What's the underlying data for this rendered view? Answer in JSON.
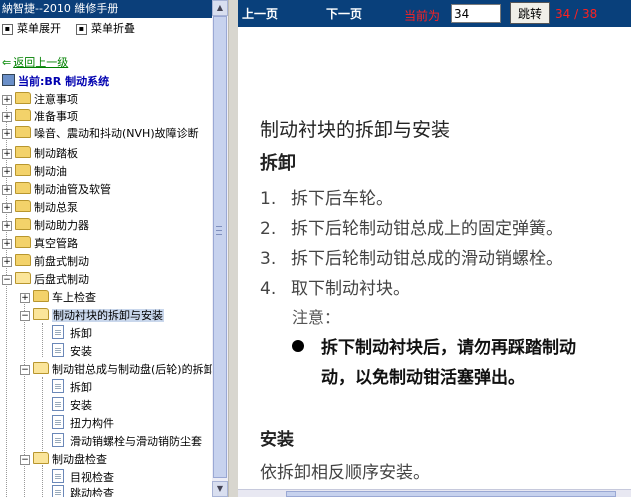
{
  "left_pane": {
    "title": "納智捷--2010 維修手册",
    "expand_all_label": "菜单展开",
    "collapse_all_label": "菜单折叠",
    "back_label": "返回上一级",
    "current_section": "当前:BR 制动系统",
    "tree": [
      {
        "label": "注意事项"
      },
      {
        "label": "准备事项"
      },
      {
        "label": "噪音、震动和抖动(NVH)故障诊断"
      },
      {
        "label": "制动踏板"
      },
      {
        "label": "制动油"
      },
      {
        "label": "制动油管及软管"
      },
      {
        "label": "制动总泵"
      },
      {
        "label": "制动助力器"
      },
      {
        "label": "真空管路"
      },
      {
        "label": "前盘式制动"
      },
      {
        "label": "后盘式制动"
      },
      {
        "label": "车上检查"
      },
      {
        "label": "制动衬块的拆卸与安装"
      },
      {
        "label": "拆卸"
      },
      {
        "label": "安装"
      },
      {
        "label": "制动钳总成与制动盘(后轮)的拆卸与安装"
      },
      {
        "label": "拆卸"
      },
      {
        "label": "安装"
      },
      {
        "label": "扭力构件"
      },
      {
        "label": "滑动销螺栓与滑动销防尘套"
      },
      {
        "label": "制动盘检查"
      },
      {
        "label": "目视检查"
      },
      {
        "label": "跳动检查"
      }
    ]
  },
  "nav": {
    "prev_label": "上一页",
    "next_label": "下一页",
    "current_label": "当前为",
    "page_value": "34",
    "jump_label": "跳转",
    "page_count": "34 / 38"
  },
  "doc": {
    "title": "制动衬块的拆卸与安装",
    "removal_heading": "拆卸",
    "steps": [
      {
        "num": "1.",
        "text": "拆下后车轮。"
      },
      {
        "num": "2.",
        "text": "拆下后轮制动钳总成上的固定弹簧。"
      },
      {
        "num": "3.",
        "text": "拆下后轮制动钳总成的滑动销螺栓。"
      },
      {
        "num": "4.",
        "text": "取下制动衬块。"
      }
    ],
    "caution_label": "注意：",
    "caution_line1": "拆下制动衬块后，请勿再踩踏制动",
    "caution_line2": "动，以免制动钳活塞弹出。",
    "install_heading": "安装",
    "install_text": "依拆卸相反顺序安装。"
  },
  "colors": {
    "nav_bg": "#09407b",
    "title_bg": "#0b3f7a",
    "highlight": "#ff2020",
    "back_link": "#008000",
    "current_section": "#0000b0"
  }
}
